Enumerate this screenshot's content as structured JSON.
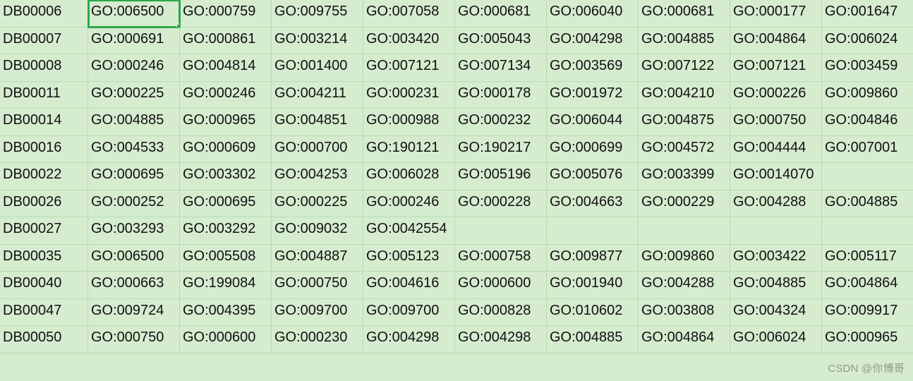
{
  "spreadsheet": {
    "active_cell": {
      "row": 0,
      "col": 1
    },
    "rows": [
      {
        "id": "DB00006",
        "cells": [
          "GO:006500",
          "GO:000759",
          "GO:009755",
          "GO:007058",
          "GO:000681",
          "GO:006040",
          "GO:000681",
          "GO:000177",
          "GO:001647"
        ]
      },
      {
        "id": "DB00007",
        "cells": [
          "GO:000691",
          "GO:000861",
          "GO:003214",
          "GO:003420",
          "GO:005043",
          "GO:004298",
          "GO:004885",
          "GO:004864",
          "GO:006024"
        ]
      },
      {
        "id": "DB00008",
        "cells": [
          "GO:000246",
          "GO:004814",
          "GO:001400",
          "GO:007121",
          "GO:007134",
          "GO:003569",
          "GO:007122",
          "GO:007121",
          "GO:003459"
        ]
      },
      {
        "id": "DB00011",
        "cells": [
          "GO:000225",
          "GO:000246",
          "GO:004211",
          "GO:000231",
          "GO:000178",
          "GO:001972",
          "GO:004210",
          "GO:000226",
          "GO:009860"
        ]
      },
      {
        "id": "DB00014",
        "cells": [
          "GO:004885",
          "GO:000965",
          "GO:004851",
          "GO:000988",
          "GO:000232",
          "GO:006044",
          "GO:004875",
          "GO:000750",
          "GO:004846"
        ]
      },
      {
        "id": "DB00016",
        "cells": [
          "GO:004533",
          "GO:000609",
          "GO:000700",
          "GO:190121",
          "GO:190217",
          "GO:000699",
          "GO:004572",
          "GO:004444",
          "GO:007001"
        ]
      },
      {
        "id": "DB00022",
        "cells": [
          "GO:000695",
          "GO:003302",
          "GO:004253",
          "GO:006028",
          "GO:005196",
          "GO:005076",
          "GO:003399",
          "GO:0014070",
          ""
        ]
      },
      {
        "id": "DB00026",
        "cells": [
          "GO:000252",
          "GO:000695",
          "GO:000225",
          "GO:000246",
          "GO:000228",
          "GO:004663",
          "GO:000229",
          "GO:004288",
          "GO:004885"
        ]
      },
      {
        "id": "DB00027",
        "cells": [
          "GO:003293",
          "GO:003292",
          "GO:009032",
          "GO:0042554",
          "",
          "",
          "",
          "",
          ""
        ]
      },
      {
        "id": "DB00035",
        "cells": [
          "GO:006500",
          "GO:005508",
          "GO:004887",
          "GO:005123",
          "GO:000758",
          "GO:009877",
          "GO:009860",
          "GO:003422",
          "GO:005117"
        ]
      },
      {
        "id": "DB00040",
        "cells": [
          "GO:000663",
          "GO:199084",
          "GO:000750",
          "GO:004616",
          "GO:000600",
          "GO:001940",
          "GO:004288",
          "GO:004885",
          "GO:004864"
        ]
      },
      {
        "id": "DB00047",
        "cells": [
          "GO:009724",
          "GO:004395",
          "GO:009700",
          "GO:009700",
          "GO:000828",
          "GO:010602",
          "GO:003808",
          "GO:004324",
          "GO:009917"
        ]
      },
      {
        "id": "DB00050",
        "cells": [
          "GO:000750",
          "GO:000600",
          "GO:000230",
          "GO:004298",
          "GO:004298",
          "GO:004885",
          "GO:004864",
          "GO:006024",
          "GO:000965"
        ]
      }
    ]
  },
  "watermark": "CSDN @你博哥"
}
